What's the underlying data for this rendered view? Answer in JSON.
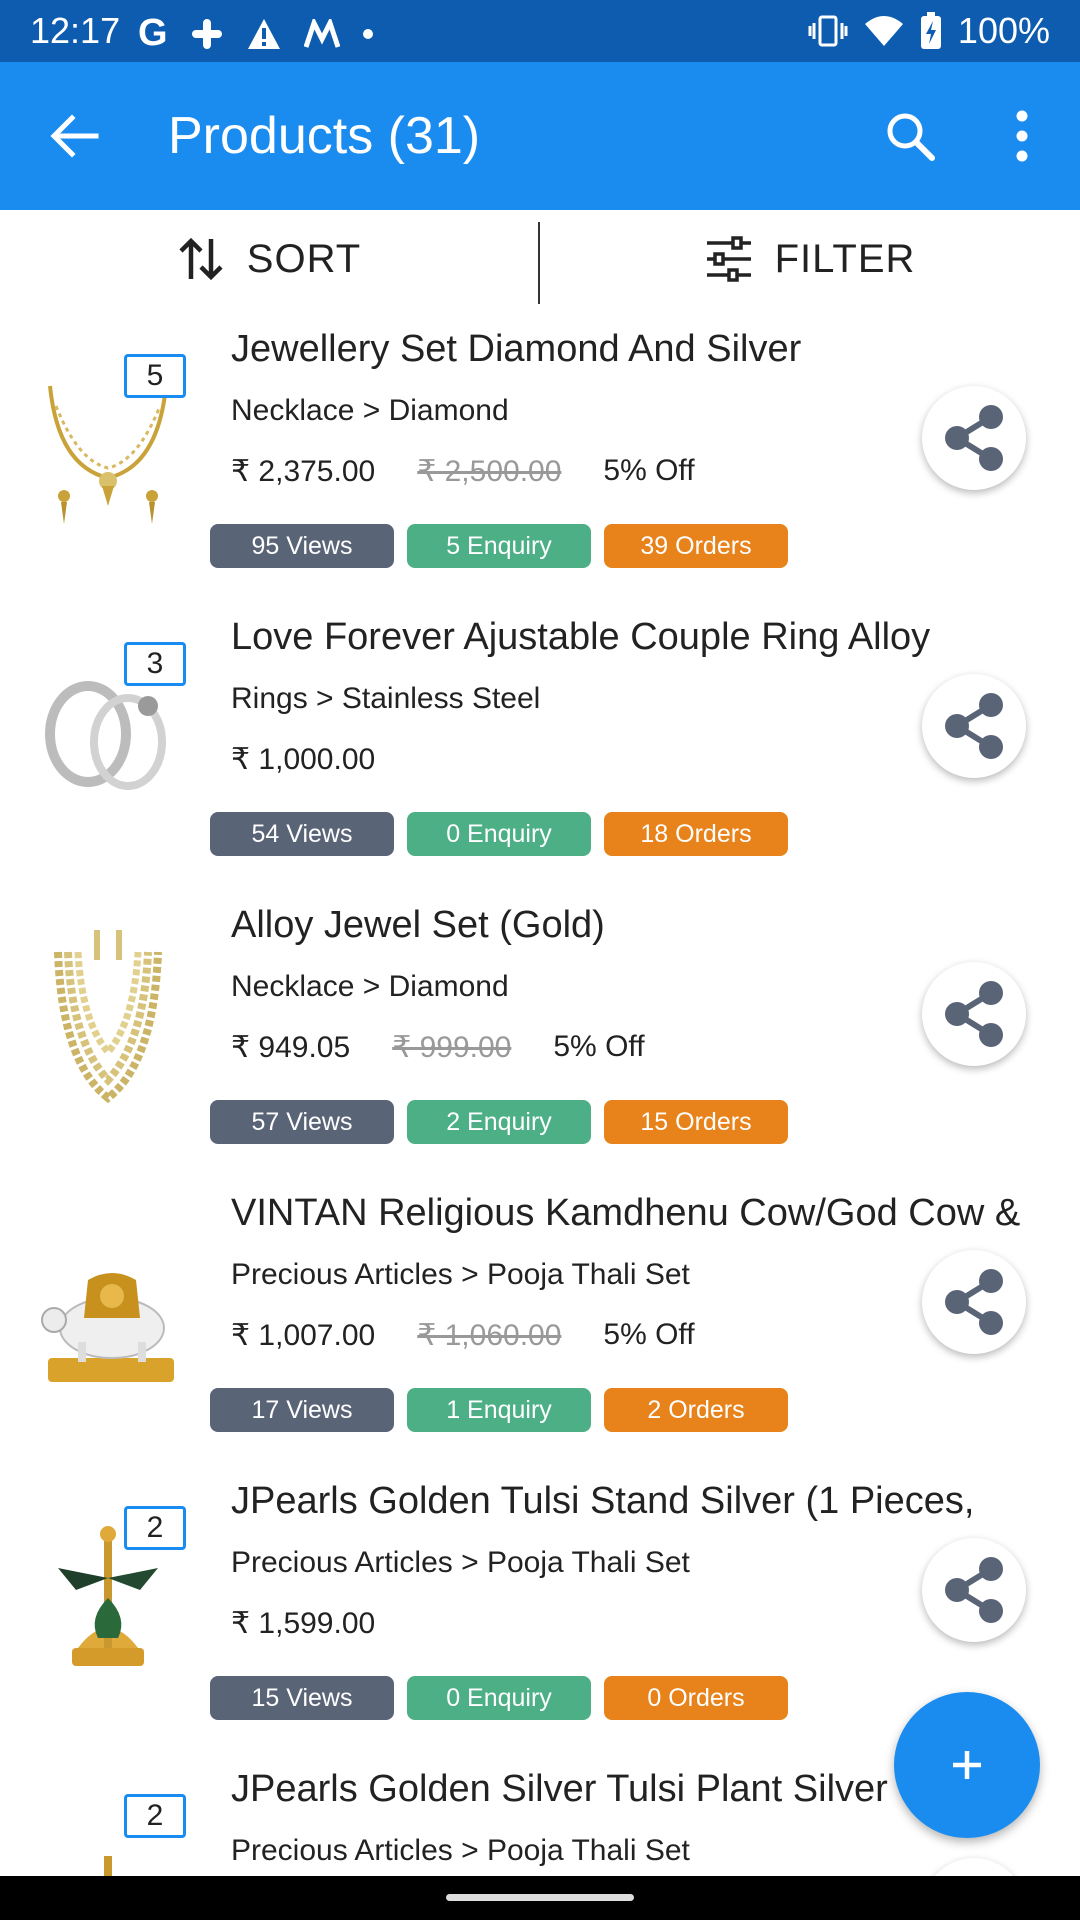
{
  "status_bar": {
    "time": "12:17",
    "battery": "100%",
    "icons": [
      "google-icon",
      "slack-icon",
      "warning-icon",
      "m-app-icon",
      "dot-icon",
      "vibrate-icon",
      "wifi-icon",
      "battery-charging-icon"
    ]
  },
  "appbar": {
    "title": "Products (31)",
    "color": "#1a8cf0",
    "icons": [
      "back-arrow-icon",
      "search-icon",
      "more-vert-icon"
    ]
  },
  "toolbar": {
    "sort_label": "SORT",
    "filter_label": "FILTER"
  },
  "products": [
    {
      "name": "Jewellery Set Diamond And Silver",
      "category": "Necklace > Diamond",
      "price": "₹ 2,375.00",
      "mrp": "₹ 2,500.00",
      "discount": "5% Off",
      "image_count": "5",
      "views": "95 Views",
      "enquiry": "5 Enquiry",
      "orders": "39 Orders"
    },
    {
      "name": "Love Forever Ajustable Couple Ring Alloy",
      "category": "Rings > Stainless Steel",
      "price": "₹ 1,000.00",
      "mrp": "",
      "discount": "",
      "image_count": "3",
      "views": "54 Views",
      "enquiry": "0 Enquiry",
      "orders": "18 Orders"
    },
    {
      "name": "Alloy Jewel Set  (Gold)",
      "category": "Necklace > Diamond",
      "price": "₹ 949.05",
      "mrp": "₹ 999.00",
      "discount": "5% Off",
      "image_count": "",
      "views": "57 Views",
      "enquiry": "2 Enquiry",
      "orders": "15 Orders"
    },
    {
      "name": "VINTAN Religious Kamdhenu Cow/God Cow &",
      "category": "Precious Articles > Pooja Thali Set",
      "price": "₹ 1,007.00",
      "mrp": "₹ 1,060.00",
      "discount": "5% Off",
      "image_count": "",
      "views": "17 Views",
      "enquiry": "1 Enquiry",
      "orders": "2 Orders"
    },
    {
      "name": "JPearls Golden Tulsi Stand Silver  (1 Pieces,",
      "category": "Precious Articles > Pooja Thali Set",
      "price": "₹ 1,599.00",
      "mrp": "",
      "discount": "",
      "image_count": "2",
      "views": "15 Views",
      "enquiry": "0 Enquiry",
      "orders": "0 Orders"
    },
    {
      "name": "JPearls Golden Silver Tulsi Plant Silver",
      "category": "Precious Articles > Pooja Thali Set",
      "price": "",
      "mrp": "",
      "discount": "",
      "image_count": "2",
      "views": "",
      "enquiry": "",
      "orders": ""
    }
  ],
  "fab": {
    "icon": "add-icon"
  }
}
